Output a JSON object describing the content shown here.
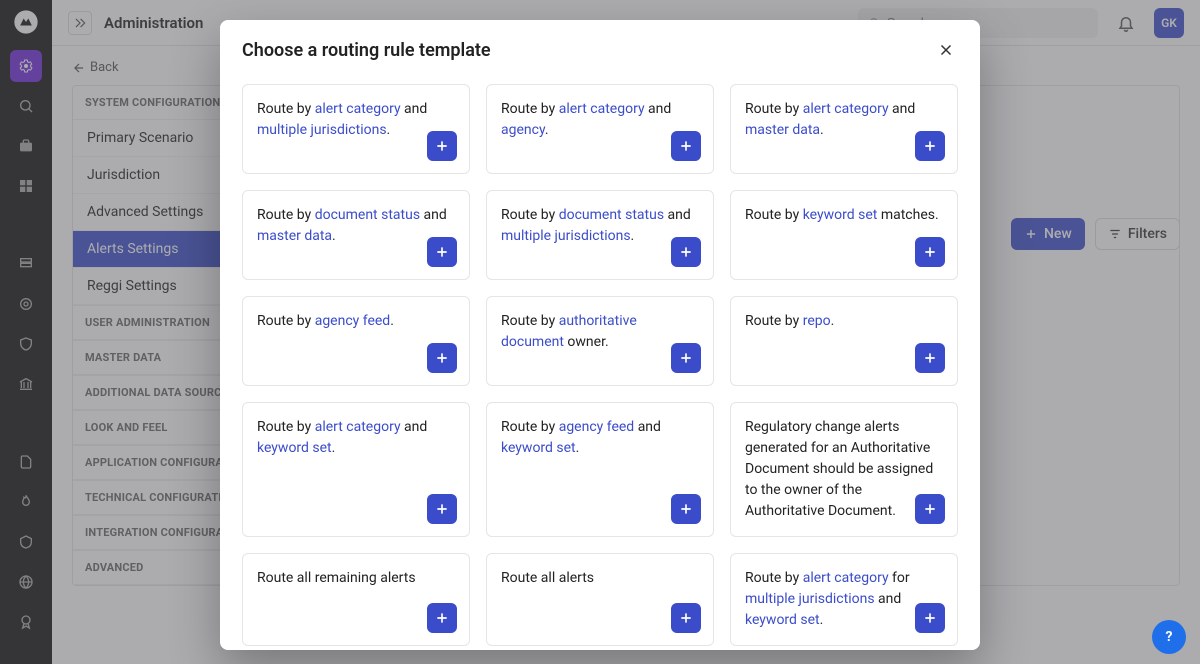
{
  "topbar": {
    "title": "Administration",
    "search_placeholder": "Search",
    "avatar": "GK"
  },
  "back_label": "Back",
  "sidebar": {
    "section1_title": "SYSTEM CONFIGURATION",
    "items": [
      {
        "label": "Primary Scenario"
      },
      {
        "label": "Jurisdiction"
      },
      {
        "label": "Advanced Settings"
      },
      {
        "label": "Alerts Settings"
      },
      {
        "label": "Reggi Settings"
      }
    ],
    "other_sections": [
      "USER ADMINISTRATION",
      "MASTER DATA",
      "ADDITIONAL DATA SOURCES",
      "LOOK AND FEEL",
      "APPLICATION CONFIGURATION",
      "TECHNICAL CONFIGURATION",
      "INTEGRATION CONFIGURATION",
      "ADVANCED"
    ]
  },
  "toolbar": {
    "new_label": "New",
    "filters_label": "Filters"
  },
  "modal": {
    "title": "Choose a routing rule template",
    "cards": [
      {
        "parts": [
          {
            "t": "Route by "
          },
          {
            "t": "alert category",
            "l": 1
          },
          {
            "t": " and "
          },
          {
            "t": "multiple jurisdictions",
            "l": 1
          },
          {
            "t": "."
          }
        ]
      },
      {
        "parts": [
          {
            "t": "Route by "
          },
          {
            "t": "alert category",
            "l": 1
          },
          {
            "t": " and "
          },
          {
            "t": "agency",
            "l": 1
          },
          {
            "t": "."
          }
        ]
      },
      {
        "parts": [
          {
            "t": "Route by "
          },
          {
            "t": "alert category",
            "l": 1
          },
          {
            "t": " and "
          },
          {
            "t": "master data",
            "l": 1
          },
          {
            "t": "."
          }
        ]
      },
      {
        "parts": [
          {
            "t": "Route by "
          },
          {
            "t": "document status",
            "l": 1
          },
          {
            "t": " and "
          },
          {
            "t": "master data",
            "l": 1
          },
          {
            "t": "."
          }
        ]
      },
      {
        "parts": [
          {
            "t": "Route by "
          },
          {
            "t": "document status",
            "l": 1
          },
          {
            "t": " and "
          },
          {
            "t": "multiple jurisdictions",
            "l": 1
          },
          {
            "t": "."
          }
        ]
      },
      {
        "parts": [
          {
            "t": "Route by "
          },
          {
            "t": "keyword set",
            "l": 1
          },
          {
            "t": " matches."
          }
        ]
      },
      {
        "parts": [
          {
            "t": "Route by "
          },
          {
            "t": "agency feed",
            "l": 1
          },
          {
            "t": "."
          }
        ]
      },
      {
        "parts": [
          {
            "t": "Route by "
          },
          {
            "t": "authoritative document",
            "l": 1
          },
          {
            "t": " owner."
          }
        ]
      },
      {
        "parts": [
          {
            "t": "Route by "
          },
          {
            "t": "repo",
            "l": 1
          },
          {
            "t": "."
          }
        ]
      },
      {
        "parts": [
          {
            "t": "Route by "
          },
          {
            "t": "alert category",
            "l": 1
          },
          {
            "t": " and "
          },
          {
            "t": "keyword set",
            "l": 1
          },
          {
            "t": "."
          }
        ]
      },
      {
        "parts": [
          {
            "t": "Route by "
          },
          {
            "t": "agency feed",
            "l": 1
          },
          {
            "t": " and "
          },
          {
            "t": "keyword set",
            "l": 1
          },
          {
            "t": "."
          }
        ]
      },
      {
        "parts": [
          {
            "t": "Regulatory change alerts generated for an Authoritative Document should be assigned to the owner of the Authoritative Document."
          }
        ]
      },
      {
        "parts": [
          {
            "t": "Route all remaining alerts"
          }
        ]
      },
      {
        "parts": [
          {
            "t": "Route all alerts"
          }
        ]
      },
      {
        "parts": [
          {
            "t": "Route by "
          },
          {
            "t": "alert category",
            "l": 1
          },
          {
            "t": " for "
          },
          {
            "t": "multiple jurisdictions",
            "l": 1
          },
          {
            "t": " and "
          },
          {
            "t": "keyword set",
            "l": 1
          },
          {
            "t": "."
          }
        ]
      }
    ]
  },
  "help": "?"
}
